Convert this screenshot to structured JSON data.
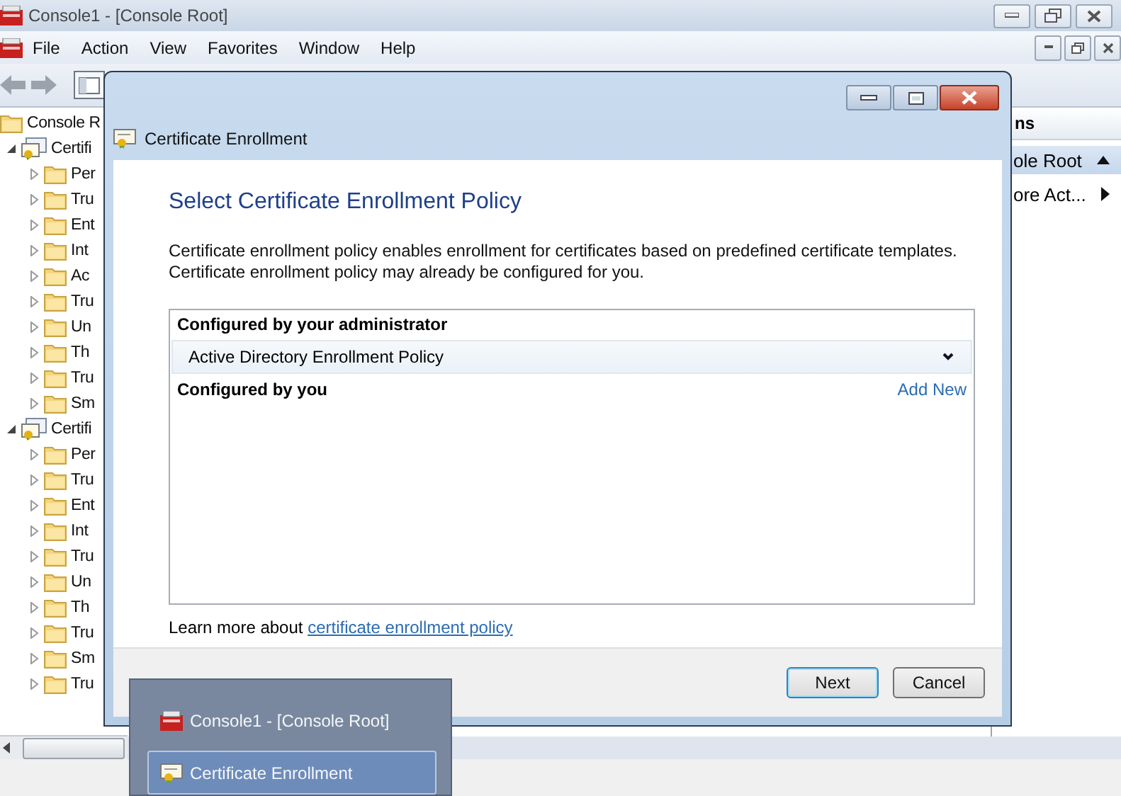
{
  "console": {
    "title": "Console1 - [Console Root]",
    "menu": [
      "File",
      "Action",
      "View",
      "Favorites",
      "Window",
      "Help"
    ],
    "tree": [
      {
        "label": "Console R",
        "kind": "folder",
        "children": [
          {
            "label": "Certifi",
            "kind": "store",
            "expanded": true,
            "children": [
              {
                "label": "Per",
                "kind": "folder",
                "expanded": false
              },
              {
                "label": "Tru",
                "kind": "folder",
                "expanded": false
              },
              {
                "label": "Ent",
                "kind": "folder",
                "expanded": false
              },
              {
                "label": "Int",
                "kind": "folder",
                "expanded": false
              },
              {
                "label": "Ac",
                "kind": "folder",
                "expanded": false
              },
              {
                "label": "Tru",
                "kind": "folder",
                "expanded": false
              },
              {
                "label": "Un",
                "kind": "folder",
                "expanded": false
              },
              {
                "label": "Th",
                "kind": "folder",
                "expanded": false
              },
              {
                "label": "Tru",
                "kind": "folder",
                "expanded": false
              },
              {
                "label": "Sm",
                "kind": "folder",
                "expanded": false
              }
            ]
          },
          {
            "label": "Certifi",
            "kind": "store",
            "expanded": true,
            "children": [
              {
                "label": "Per",
                "kind": "folder",
                "expanded": false
              },
              {
                "label": "Tru",
                "kind": "folder",
                "expanded": false
              },
              {
                "label": "Ent",
                "kind": "folder",
                "expanded": false
              },
              {
                "label": "Int",
                "kind": "folder",
                "expanded": false
              },
              {
                "label": "Tru",
                "kind": "folder",
                "expanded": false
              },
              {
                "label": "Un",
                "kind": "folder",
                "expanded": false
              },
              {
                "label": "Th",
                "kind": "folder",
                "expanded": false
              },
              {
                "label": "Tru",
                "kind": "folder",
                "expanded": false
              },
              {
                "label": "Sm",
                "kind": "folder",
                "expanded": false
              },
              {
                "label": "Tru",
                "kind": "folder",
                "expanded": false
              }
            ]
          }
        ]
      }
    ],
    "actions": {
      "header": "ns",
      "items": [
        {
          "label": "ole Root",
          "kind": "section"
        },
        {
          "label": "ore Act...",
          "kind": "submenu"
        }
      ]
    }
  },
  "dialog": {
    "title": "Certificate Enrollment",
    "heading": "Select Certificate Enrollment Policy",
    "description": [
      "Certificate enrollment policy enables enrollment for certificates based on predefined certificate templates.",
      "Certificate enrollment policy may already be configured for you."
    ],
    "admin_header": "Configured by your administrator",
    "policy": "Active Directory Enrollment Policy",
    "user_header": "Configured by you",
    "add_new": "Add New",
    "learn_more": "Learn more about",
    "learn_more_link": "certificate enrollment policy",
    "buttons": [
      {
        "label": "Next",
        "default": true
      },
      {
        "label": "Cancel",
        "default": false
      }
    ]
  },
  "taskbar_preview": {
    "items": [
      {
        "title": "Console1 - [Console Root]",
        "kind": "console",
        "selected": false
      },
      {
        "title": "Certificate Enrollment",
        "kind": "certificate",
        "selected": true
      }
    ]
  }
}
